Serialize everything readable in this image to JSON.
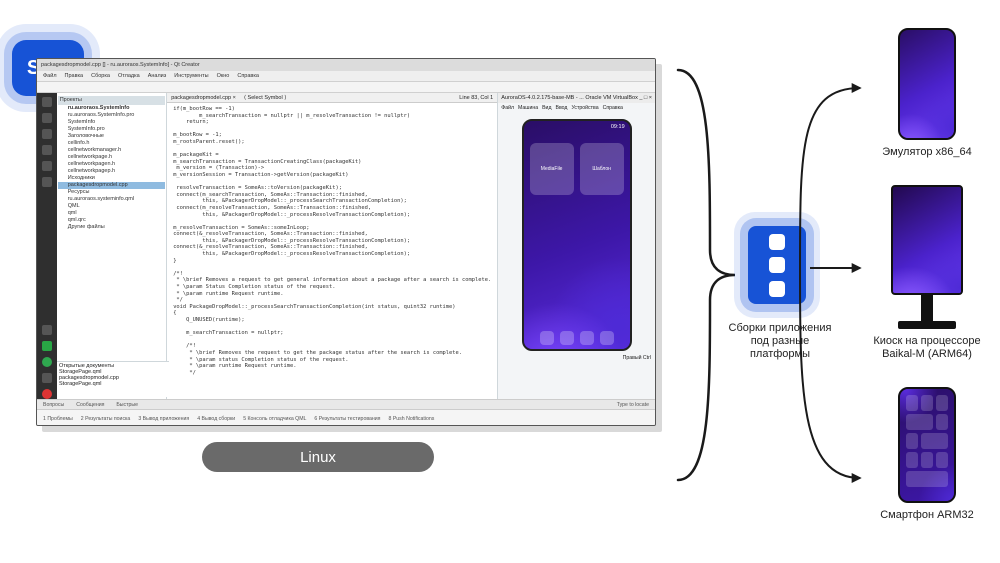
{
  "badge": {
    "label": "SDK"
  },
  "ide": {
    "title": "packagesdropmodel.cpp [] - ru.auroraos.SystemInfo] - Qt Creator",
    "menubar": [
      "Файл",
      "Правка",
      "Сборка",
      "Отладка",
      "Анализ",
      "Инструменты",
      "Окно",
      "Справка"
    ],
    "editor_tabs": [
      "packagesdropmodel.cpp ×",
      "⟨ Select Symbol ⟩"
    ],
    "line_indicator": "Line 83, Col 1",
    "project": {
      "header": "Проекты",
      "root": "ru.auroraos.SystemInfo",
      "subroot": "ru.auroraos.SystemInfo.pro",
      "items": [
        "SystemInfo",
        "SystemInfo.pro",
        "Заголовочные",
        " cellinfo.h",
        " cellnetworkmanager.h",
        " cellnetworkpage.h",
        " cellnetworkpagen.h",
        " cellnetworkpagep.h",
        "Исходники",
        "packagesdropmodel.cpp",
        "Ресурсы",
        "ru.auroraos.systeminfo.qml",
        "QML",
        "qml",
        "qml.qrc",
        "Другие файлы"
      ],
      "selected": "packagesdropmodel.cpp"
    },
    "open_docs": {
      "header": "Открытые документы",
      "items": [
        "StoragePage.qml",
        "packagesdropmodel.cpp",
        "StoragePage.qml"
      ]
    },
    "statusbar": [
      "Вопросы",
      "Сообщения",
      "Быстрые",
      "",
      "Type to locate"
    ],
    "output_tabs": [
      "1 Проблемы",
      "2 Результаты поиска",
      "3 Вывод приложения",
      "4 Вывод сборки",
      "5 Консоль отладчика QML",
      "6 Результаты тестирования",
      "8 Push Notifications"
    ],
    "editor_text": "if(m_bootRow == -1)\n        m_searchTransaction = nullptr || m_resolveTransaction != nullptr)\n    return;\n\nm_bootRow = -1;\nm_rootsParent.reset();\n\nm_packageKit = \nm_searchTransaction = TransactionCreatingClass(packageKit)\n m_version = (Transaction)->\nm_versionSession = Transaction->getVersion(packageKit)\n\n resolveTransaction = SomeAs::toVersion(packageKit);\n connect(m_searchTransaction, SomeAs::Transaction::finished,\n         this, &PackagerDropModel::_processSearchTransactionCompletion);\n connect(m_resolveTransaction, SomeAs::Transaction::finished,\n         this, &PackagerDropModel::_processResolveTransactionCompletion);\n\nm_resolveTransaction = SomeAs::someInLoop;\nconnect(&_resolveTransaction, SomeAs::Transaction::finished,\n         this, &PackagerDropModel::_processResolveTransactionCompletion);\nconnect(&_resolveTransaction, SomeAs::Transaction::finished,\n         this, &PackagerDropModel::_processResolveTransactionCompletion);\n}\n\n/*!\n * \\brief Removes a request to get general information about a package after a search is complete.\n * \\param Status Completion status of the request.\n * \\param runtime Request runtime.\n */\nvoid PackageDropModel::_processSearchTransactionCompletion(int status, quint32 runtime)\n{\n    Q_UNUSED(runtime);\n\n    m_searchTransaction = nullptr;\n\n    /*!\n     * \\brief Removes the request to get the package status after the search is complete.\n     * \\param status Completion status of the request.\n     * \\param runtime Request runtime.\n     */",
    "vm": {
      "title_left": "AuroraOS-4.0.2.175-base-MB - ...",
      "title_right": "Oracle VM VirtualBox  _ □ ×",
      "tabs": [
        "Файл",
        "Машина",
        "Вид",
        "Ввод",
        "Устройства",
        "Справка"
      ],
      "clock": "09:19",
      "cards": [
        "MediaFile",
        "Шаблон"
      ],
      "footer_right": "Правый Ctrl"
    }
  },
  "linux_pill": "Linux",
  "build": {
    "label_line1": "Сборки приложения",
    "label_line2": "под разные",
    "label_line3": "платформы"
  },
  "targets": [
    {
      "name": "emulator",
      "label": "Эмулятор x86_64"
    },
    {
      "name": "kiosk",
      "label": "Киоск на процессоре\nBaikal-M (ARM64)"
    },
    {
      "name": "phone",
      "label": "Смартфон ARM32"
    }
  ]
}
